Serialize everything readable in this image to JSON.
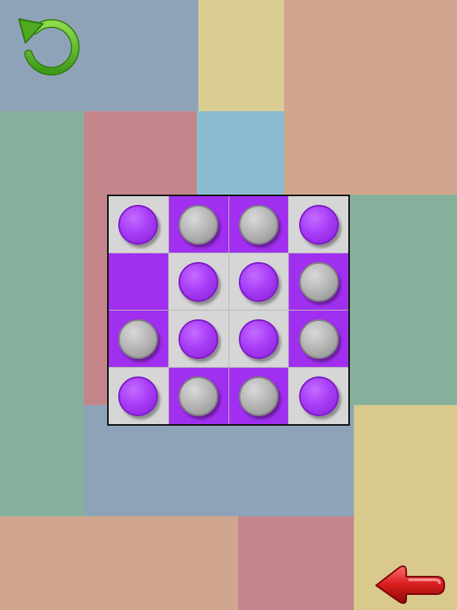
{
  "colors": {
    "tile_purple": "#a12ff0",
    "tile_gray": "#d6d6d6",
    "piece_purple": "#a93ef7",
    "piece_gray": "#b4b4b4",
    "undo_icon": "#5fb82a",
    "back_arrow": "#d61a1a"
  },
  "icons": {
    "undo": "undo-arrow-icon",
    "back": "back-arrow-icon"
  },
  "board": {
    "rows": 4,
    "cols": 4,
    "cells": [
      [
        {
          "tile": "gray",
          "piece": "purple"
        },
        {
          "tile": "purple",
          "piece": "gray"
        },
        {
          "tile": "purple",
          "piece": "gray"
        },
        {
          "tile": "gray",
          "piece": "purple"
        }
      ],
      [
        {
          "tile": "purple",
          "piece": null
        },
        {
          "tile": "gray",
          "piece": "purple"
        },
        {
          "tile": "gray",
          "piece": "purple"
        },
        {
          "tile": "purple",
          "piece": "gray"
        }
      ],
      [
        {
          "tile": "purple",
          "piece": "gray"
        },
        {
          "tile": "gray",
          "piece": "purple"
        },
        {
          "tile": "gray",
          "piece": "purple"
        },
        {
          "tile": "purple",
          "piece": "gray"
        }
      ],
      [
        {
          "tile": "gray",
          "piece": "purple"
        },
        {
          "tile": "purple",
          "piece": "gray"
        },
        {
          "tile": "purple",
          "piece": "gray"
        },
        {
          "tile": "gray",
          "piece": "purple"
        }
      ]
    ]
  }
}
